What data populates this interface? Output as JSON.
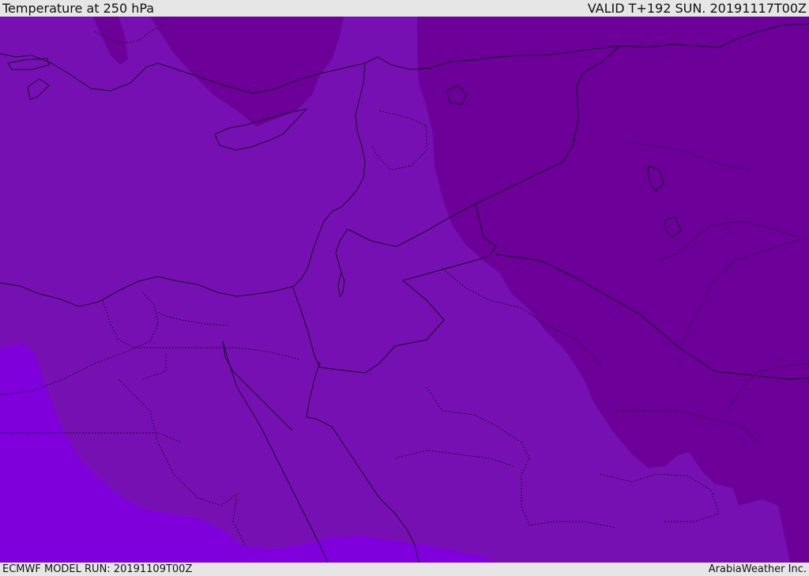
{
  "header": {
    "title": "Temperature at 250 hPa",
    "valid_time": "VALID T+192 SUN. 20191117T00Z"
  },
  "footer": {
    "model_run": "ECMWF MODEL RUN: 20191109T00Z",
    "credit": "ArabiaWeather Inc."
  },
  "colors": {
    "band_warm": "#8000dc",
    "band_mid": "#7710b2",
    "band_cold": "#6c0098",
    "band_coldest": "#640090",
    "coastline": "#1a1030",
    "border": "#150c28"
  }
}
